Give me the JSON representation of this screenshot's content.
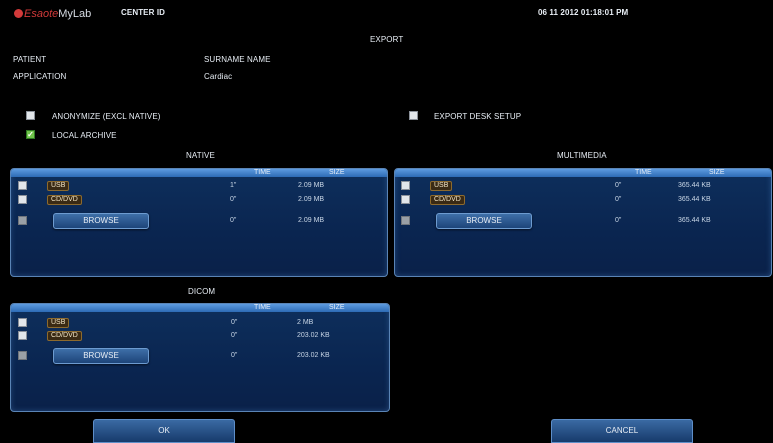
{
  "header": {
    "logo_text": "Esaote MyLab",
    "logo_brand": "Esaote",
    "logo_product": "MyLab",
    "center_id_label": "CENTER ID",
    "datetime": "06 11 2012 01:18:01 PM"
  },
  "title": "EXPORT",
  "info": {
    "patient_label": "PATIENT",
    "patient_value": "SURNAME NAME",
    "application_label": "APPLICATION",
    "application_value": "Cardiac"
  },
  "options": {
    "anonymize": {
      "label": "ANONYMIZE (EXCL NATIVE)",
      "checked": false
    },
    "local_archive": {
      "label": "LOCAL ARCHIVE",
      "checked": true
    },
    "export_desk_setup": {
      "label": "EXPORT DESK SETUP",
      "checked": false
    }
  },
  "panels": {
    "native": {
      "title": "NATIVE",
      "time_header": "TIME",
      "size_header": "SIZE",
      "rows": [
        {
          "device": "USB",
          "time": "1\"",
          "size": "2.09 MB"
        },
        {
          "device": "CD/DVD",
          "time": "0\"",
          "size": "2.09 MB"
        },
        {
          "device": "BROWSE",
          "time": "0\"",
          "size": "2.09 MB"
        }
      ]
    },
    "multimedia": {
      "title": "MULTIMEDIA",
      "time_header": "TIME",
      "size_header": "SIZE",
      "rows": [
        {
          "device": "USB",
          "time": "0\"",
          "size": "365.44 KB"
        },
        {
          "device": "CD/DVD",
          "time": "0\"",
          "size": "365.44 KB"
        },
        {
          "device": "BROWSE",
          "time": "0\"",
          "size": "365.44 KB"
        }
      ]
    },
    "dicom": {
      "title": "DICOM",
      "time_header": "TIME",
      "size_header": "SIZE",
      "rows": [
        {
          "device": "USB",
          "time": "0\"",
          "size": "2 MB"
        },
        {
          "device": "CD/DVD",
          "time": "0\"",
          "size": "203.02 KB"
        },
        {
          "device": "BROWSE",
          "time": "0\"",
          "size": "203.02 KB"
        }
      ]
    }
  },
  "footer": {
    "ok_label": "OK",
    "cancel_label": "CANCEL"
  }
}
